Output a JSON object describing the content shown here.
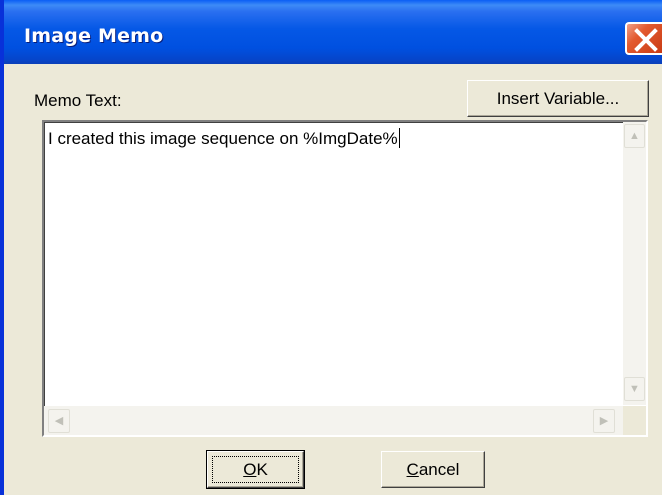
{
  "window": {
    "title": "Image Memo"
  },
  "memo": {
    "label": "Memo Text:",
    "value": "I created this image sequence on %ImgDate%"
  },
  "buttons": {
    "insert_variable": "Insert Variable...",
    "ok": "OK",
    "ok_accel": "O",
    "ok_rest": "K",
    "cancel_accel": "C",
    "cancel_rest": "ancel"
  },
  "icons": {
    "close": "close-icon",
    "scroll_up": "chevron-up-icon",
    "scroll_down": "chevron-down-icon",
    "scroll_left": "chevron-left-icon",
    "scroll_right": "chevron-right-icon"
  },
  "colors": {
    "titlebar": "#0a5ef5",
    "dialog_bg": "#ece9d8",
    "close_button": "#e35a2f"
  }
}
